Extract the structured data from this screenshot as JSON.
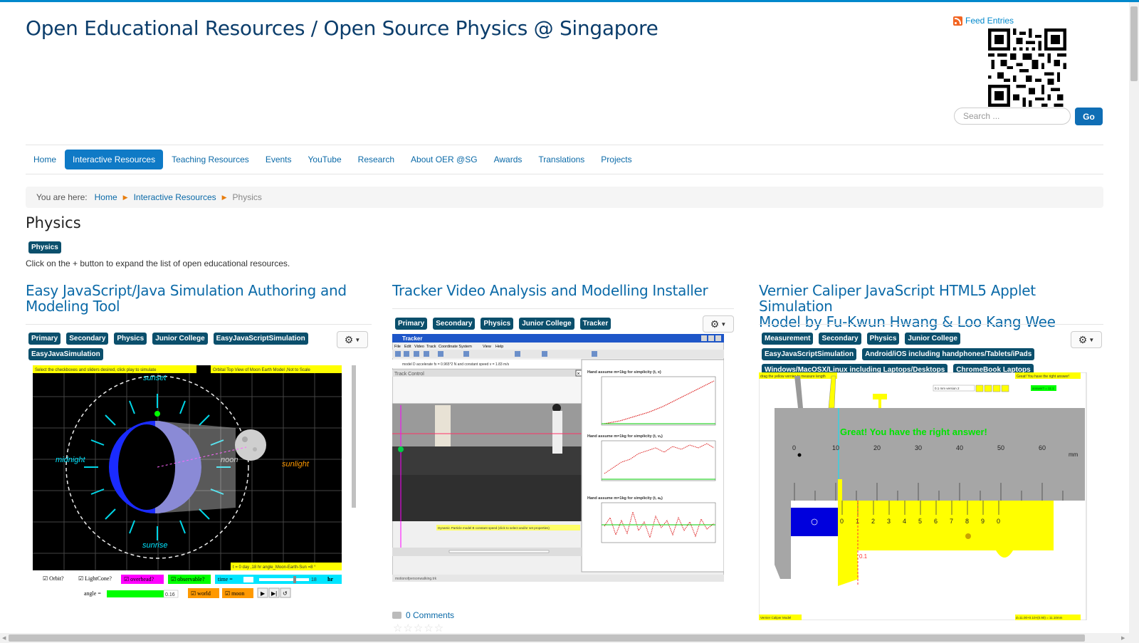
{
  "site": {
    "title": "Open Educational Resources / Open Source Physics @ Singapore"
  },
  "feed": {
    "label": "Feed Entries"
  },
  "search": {
    "placeholder": "Search ...",
    "button": "Go"
  },
  "nav": {
    "items": [
      {
        "label": "Home",
        "active": false
      },
      {
        "label": "Interactive Resources",
        "active": true
      },
      {
        "label": "Teaching Resources",
        "active": false
      },
      {
        "label": "Events",
        "active": false
      },
      {
        "label": "YouTube",
        "active": false
      },
      {
        "label": "Research",
        "active": false
      },
      {
        "label": "About OER @SG",
        "active": false
      },
      {
        "label": "Awards",
        "active": false
      },
      {
        "label": "Translations",
        "active": false
      },
      {
        "label": "Projects",
        "active": false
      }
    ]
  },
  "breadcrumb": {
    "label": "You are here:",
    "home": "Home",
    "section": "Interactive Resources",
    "current": "Physics"
  },
  "page": {
    "title": "Physics",
    "tag": "Physics",
    "intro": "Click on the + button to expand the list of open educational resources."
  },
  "cards": [
    {
      "title_line1": "Easy JavaScript/Java Simulation Authoring and",
      "title_line2": "Modeling Tool",
      "tags": [
        "Primary",
        "Secondary",
        "Physics",
        "Junior College",
        "EasyJavaScriptSimulation",
        "EasyJavaSimulation"
      ]
    },
    {
      "title_line1": "Tracker Video Analysis and Modelling Installer",
      "tags": [
        "Primary",
        "Secondary",
        "Physics",
        "Junior College",
        "Tracker"
      ]
    },
    {
      "title_line1": "Vernier Caliper JavaScript HTML5 Applet Simulation",
      "title_line2": "Model by Fu-Kwun Hwang & Loo Kang Wee",
      "tags": [
        "Measurement",
        "Secondary",
        "Physics",
        "Junior College",
        "EasyJavaScriptSimulation",
        "Android/iOS including handphones/Tablets/iPads",
        "Windows/MacOSX/Linux including Laptops/Desktops",
        "ChromeBook Laptops"
      ]
    }
  ],
  "moon_sim": {
    "top_left": "Select the checkboxes and sliders desired, click play to simulate",
    "top_right": "Orbital Top View of Moon Earth Model ,Not to Scale",
    "sunset": "sunset",
    "midnight": "midnight",
    "noon": "noon",
    "sunlight": "sunlight",
    "sunrise": "sunrise",
    "status": "t = 0 day ,18 hr angle_Moon-Earth-Sun =8 °",
    "orbit": "Orbit?",
    "lightcone": "LightCone?",
    "overhead": "overhead?",
    "observable": "observable?",
    "time": "time =",
    "time_value": "18",
    "hr": "hr",
    "angle": "angle =",
    "angle_value": "0.16",
    "world": "world",
    "moon": "moon"
  },
  "tracker": {
    "title": "Tracker",
    "menu": [
      "File",
      "Edit",
      "Video",
      "Track",
      "Coordinate System",
      "View",
      "Help"
    ],
    "track_control": "Track Control",
    "plot1": "Hand assume m=1kg for simplicity (t, x)",
    "plot2": "Hand assume m=1kg for simplicity (t, vₓ)",
    "plot3": "Hand assume m=1kg for simplicity (t, aₓ)",
    "model_label": "model D accelerate fx = 0.965*2 N and constant speed v = 1.83 m/s",
    "filename": "motionofpersonwalking.trk",
    "bottom_tip": "Dynamic Particle model B constant speed (click to select and/or set properties)"
  },
  "caliper": {
    "top_left": "drag the yellow vernier to measure length",
    "top_right": "Great! You have the right answer!",
    "success": "Great! You have the right answer!",
    "version": "0.1 mm version 2",
    "answer": "answer? = 11.1",
    "main_scale": [
      "0",
      "10",
      "20",
      "30",
      "40",
      "50",
      "60"
    ],
    "unit": "mm",
    "vernier_scale": [
      "0",
      "1",
      "2",
      "3",
      "4",
      "5",
      "6",
      "7",
      "8",
      "9",
      "0"
    ],
    "marker": "0.1",
    "bottom_left": "Vernier Caliper Model",
    "bottom_right": "d=11.00+0.10×(0.90) = 11.10mm"
  },
  "comments": {
    "label": "0 Comments"
  },
  "colors": {
    "accent": "#0f7ac6",
    "link": "#0b6aa8",
    "tag": "#0b4f6c",
    "title": "#0b3d6b"
  }
}
